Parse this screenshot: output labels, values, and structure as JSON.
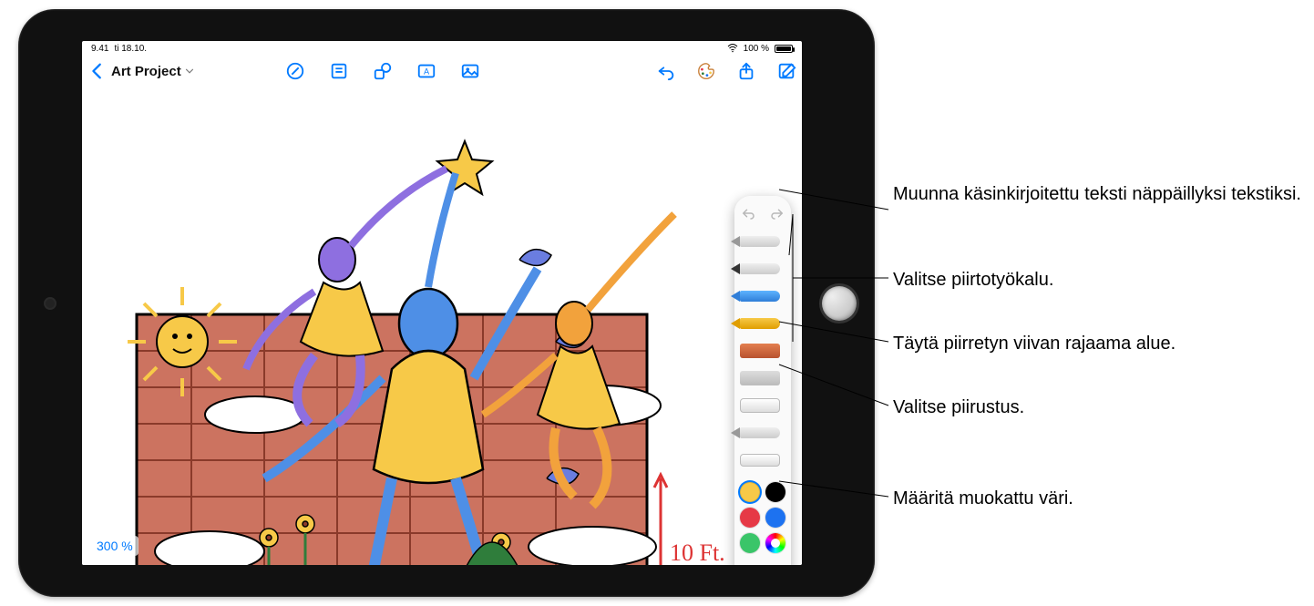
{
  "statusbar": {
    "time": "9.41",
    "date": "ti 18.10.",
    "battery_pct": "100 %",
    "wifi_icon": "wifi"
  },
  "header": {
    "back_icon": "chevron-left",
    "title": "Art Project",
    "title_chevron": "chevron-down",
    "center_tools": [
      {
        "name": "draw-mode-toggle",
        "icon": "pencil-circle"
      },
      {
        "name": "note-button",
        "icon": "note"
      },
      {
        "name": "shapes-button",
        "icon": "shapes"
      },
      {
        "name": "textbox-button",
        "icon": "textbox"
      },
      {
        "name": "media-button",
        "icon": "photo"
      }
    ],
    "right_tools": [
      {
        "name": "undo-button",
        "icon": "arrow-uturn-left"
      },
      {
        "name": "color-palette-button",
        "icon": "paintpalette"
      },
      {
        "name": "share-button",
        "icon": "square-arrow-up"
      },
      {
        "name": "compose-button",
        "icon": "square-pencil"
      }
    ]
  },
  "canvas": {
    "zoom_label": "300 %",
    "height_annotation": "10 Ft."
  },
  "palette": {
    "undo": "undo",
    "redo": "redo",
    "tools": [
      {
        "name": "scribble-tool",
        "label": "Scribble"
      },
      {
        "name": "pen-tool",
        "label": "Pen"
      },
      {
        "name": "pencil-tool",
        "label": "Pencil"
      },
      {
        "name": "marker-tool",
        "label": "Marker"
      },
      {
        "name": "crayon-tool",
        "label": "Crayon"
      },
      {
        "name": "fill-tool",
        "label": "Fill"
      },
      {
        "name": "eraser-tool",
        "label": "Eraser"
      },
      {
        "name": "lasso-tool",
        "label": "Lasso selection"
      },
      {
        "name": "ruler-tool",
        "label": "Ruler"
      }
    ],
    "swatches": [
      {
        "name": "swatch-yellow",
        "color": "#f7c948",
        "selected": true
      },
      {
        "name": "swatch-black",
        "color": "#000000",
        "selected": false
      },
      {
        "name": "swatch-red",
        "color": "#e63946",
        "selected": false
      },
      {
        "name": "swatch-blue",
        "color": "#1d72f0",
        "selected": false
      },
      {
        "name": "swatch-green",
        "color": "#3ac569",
        "selected": false
      },
      {
        "name": "swatch-custom-color",
        "color": "wheel",
        "selected": false
      }
    ],
    "more": "…"
  },
  "callouts": {
    "scribble": "Muunna käsinkirjoitettu teksti näppäillyksi tekstiksi.",
    "draw_tool": "Valitse piirtotyökalu.",
    "fill": "Täytä piirretyn viivan rajaama alue.",
    "lasso": "Valitse piirustus.",
    "color": "Määritä muokattu väri."
  },
  "colors": {
    "accent": "#007aff",
    "brick": "#c35b44",
    "person_blue": "#4e8fe6",
    "shirt_yellow": "#f7c948",
    "purple": "#8e6fe0",
    "orange": "#f2a23c",
    "green": "#2f7d3b"
  }
}
